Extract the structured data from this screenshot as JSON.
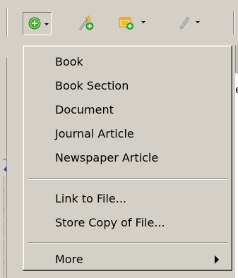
{
  "toolbar": {
    "buttons": [
      {
        "icon": "add-circle-icon",
        "has_dropdown": true,
        "pressed": true
      },
      {
        "icon": "magic-wand-add-icon",
        "has_dropdown": false
      },
      {
        "icon": "note-add-icon",
        "has_dropdown": true
      },
      {
        "icon": "paperclip-icon",
        "has_dropdown": true
      }
    ]
  },
  "background": {
    "right_fragment": "e"
  },
  "menu": {
    "items": [
      {
        "label": "Book"
      },
      {
        "label": "Book Section"
      },
      {
        "label": "Document"
      },
      {
        "label": "Journal Article"
      },
      {
        "label": "Newspaper Article"
      }
    ],
    "file_items": [
      {
        "label": "Link to File..."
      },
      {
        "label": "Store Copy of File..."
      }
    ],
    "more": {
      "label": "More",
      "has_submenu": true
    }
  },
  "colors": {
    "face": "#d4d0c8",
    "green_icon": "#3fae2a",
    "folder_orange": "#f0a830"
  }
}
